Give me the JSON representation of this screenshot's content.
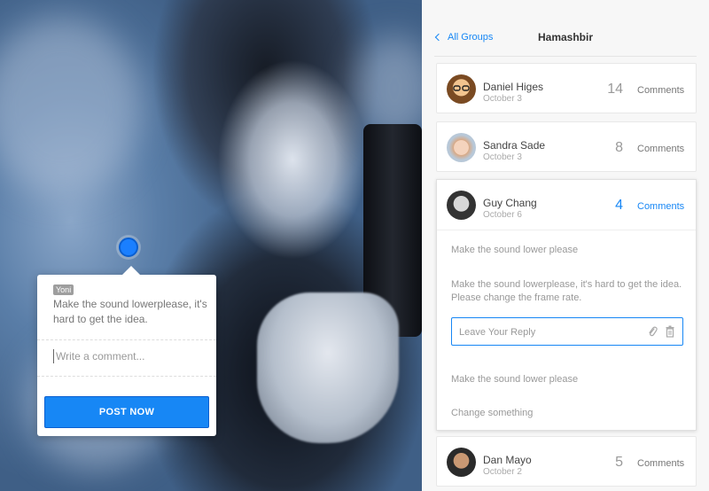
{
  "popup": {
    "user": "Yoni",
    "text": "Make the sound lowerplease, it's hard to get the idea.",
    "input_placeholder": "Write a comment...",
    "post_button": "POST NOW"
  },
  "header": {
    "back_label": "All Groups",
    "title": "Hamashbir"
  },
  "threads": [
    {
      "name": "Daniel Higes",
      "date": "October 3",
      "count": "14",
      "label": "Comments"
    },
    {
      "name": "Sandra Sade",
      "date": "October 3",
      "count": "8",
      "label": "Comments"
    },
    {
      "name": "Guy Chang",
      "date": "October 6",
      "count": "4",
      "label": "Comments"
    },
    {
      "name": "Dan Mayo",
      "date": "October 2",
      "count": "5",
      "label": "Comments"
    }
  ],
  "expanded_replies": {
    "items": [
      "Make the sound lower please",
      "Make the sound lowerplease, it's hard to get the idea. Please change the frame rate.",
      "Make the sound lower please",
      "Change something"
    ],
    "reply_placeholder": "Leave Your Reply"
  },
  "colors": {
    "accent": "#1787f5",
    "marker": "#1a7fff"
  }
}
